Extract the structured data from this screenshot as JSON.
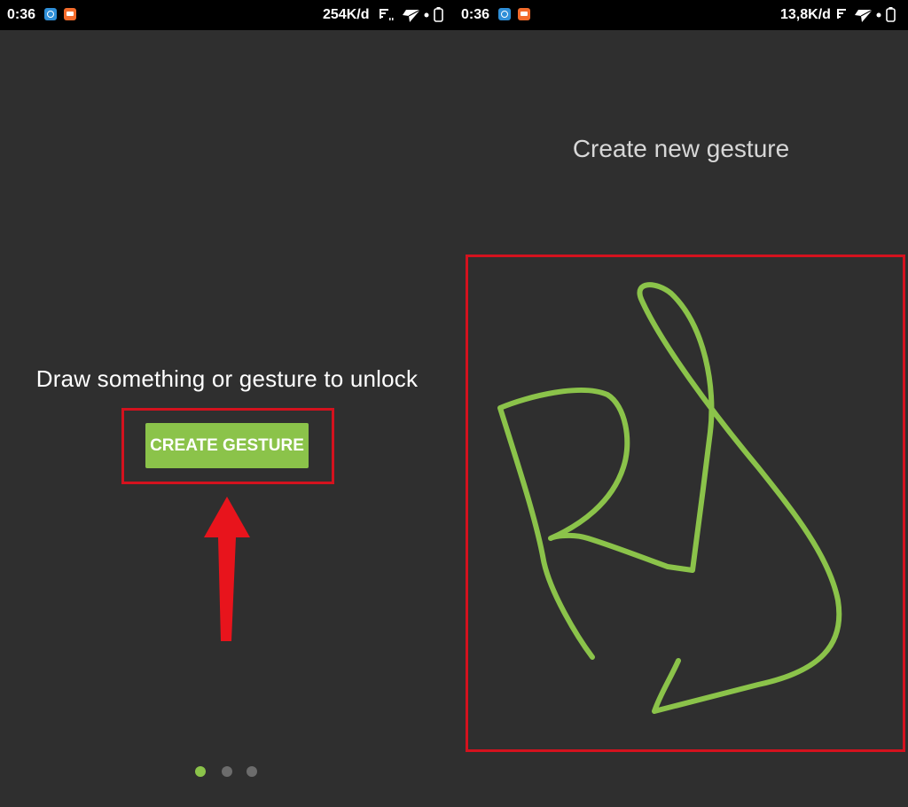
{
  "colors": {
    "background": "#2f2f2f",
    "statusbar": "#000000",
    "accent": "#8bc34a",
    "highlight": "#d4121e",
    "arrow": "#e8141c",
    "dot_inactive": "#6c6c6c"
  },
  "left_screen": {
    "statusbar": {
      "time": "0:36",
      "netspeed": "254K/d",
      "icons": [
        "browser-app-icon",
        "camera-app-icon",
        "signal-icon",
        "airplane-icon",
        "dot-icon",
        "battery-icon"
      ]
    },
    "prompt": "Draw something or gesture to unlock",
    "create_button_label": "CREATE GESTURE",
    "pager": {
      "count": 3,
      "active_index": 0
    }
  },
  "right_screen": {
    "statusbar": {
      "time": "0:36",
      "netspeed": "13,8K/d",
      "icons": [
        "browser-app-icon",
        "camera-app-icon",
        "signal-icon",
        "airplane-icon",
        "dot-icon",
        "battery-icon"
      ]
    },
    "title": "Create new gesture"
  }
}
